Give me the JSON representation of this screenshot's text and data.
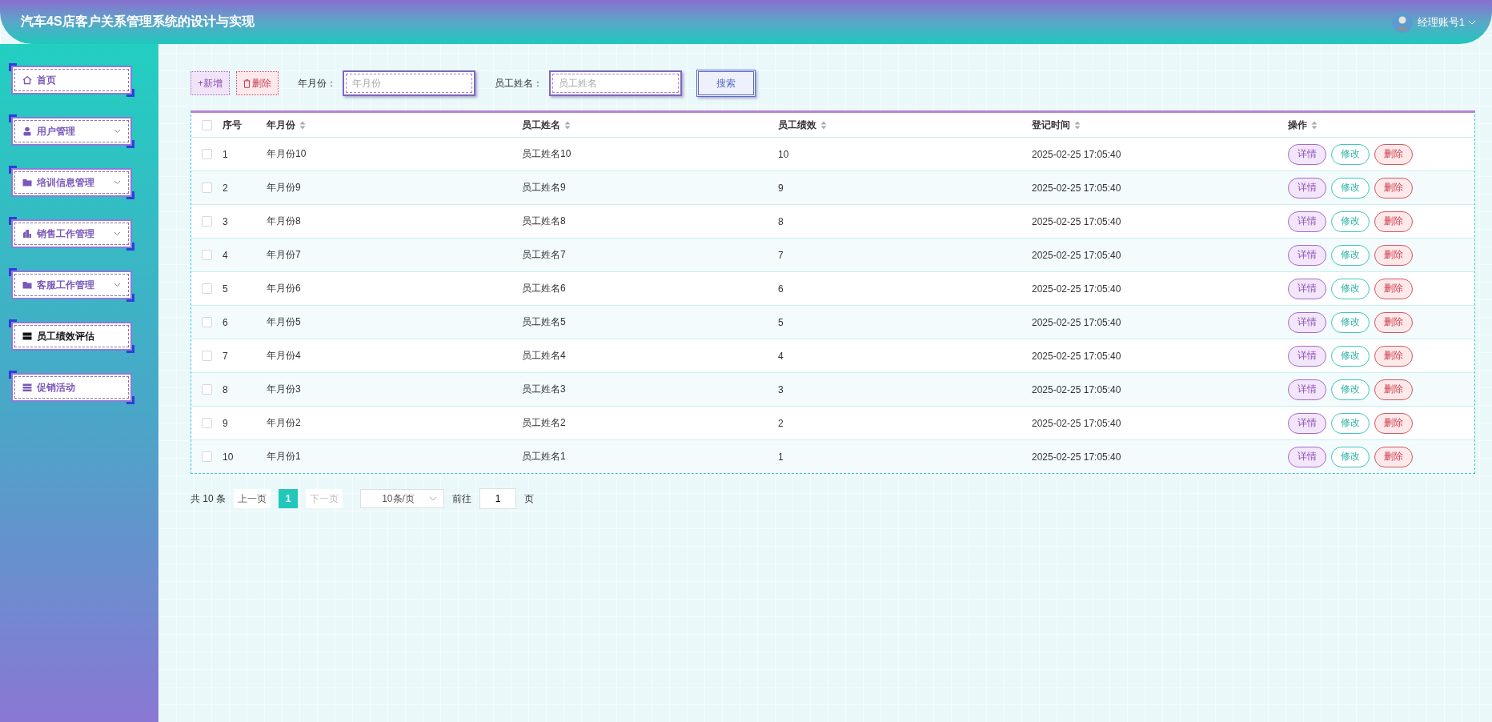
{
  "header": {
    "title": "汽车4S店客户关系管理系统的设计与实现",
    "user": "经理账号1"
  },
  "sidebar": {
    "items": [
      {
        "label": "首页",
        "kind": "link",
        "selected": false
      },
      {
        "label": "用户管理",
        "kind": "menu",
        "selected": false
      },
      {
        "label": "培训信息管理",
        "kind": "menu",
        "selected": false
      },
      {
        "label": "销售工作管理",
        "kind": "menu",
        "selected": false
      },
      {
        "label": "客服工作管理",
        "kind": "menu",
        "selected": false
      },
      {
        "label": "员工绩效评估",
        "kind": "link",
        "selected": true
      },
      {
        "label": "促销活动",
        "kind": "link",
        "selected": false
      }
    ]
  },
  "toolbar": {
    "add": "+新增",
    "delete": "删除",
    "filters": [
      {
        "label": "年月份：",
        "placeholder": "年月份"
      },
      {
        "label": "员工姓名：",
        "placeholder": "员工姓名"
      }
    ],
    "search": "搜索"
  },
  "table": {
    "all_checked": false,
    "columns": [
      {
        "label": "序号",
        "sortable": false
      },
      {
        "label": "年月份",
        "sortable": true
      },
      {
        "label": "员工姓名",
        "sortable": true
      },
      {
        "label": "员工绩效",
        "sortable": true
      },
      {
        "label": "登记时间",
        "sortable": true
      },
      {
        "label": "操作",
        "sortable": true
      }
    ],
    "rows": [
      {
        "checked": false,
        "cells": [
          "1",
          "年月份10",
          "员工姓名10",
          "10",
          "2025-02-25 17:05:40"
        ],
        "actions": [
          "详情",
          "修改",
          "删除"
        ]
      },
      {
        "checked": false,
        "cells": [
          "2",
          "年月份9",
          "员工姓名9",
          "9",
          "2025-02-25 17:05:40"
        ],
        "actions": [
          "详情",
          "修改",
          "删除"
        ]
      },
      {
        "checked": false,
        "cells": [
          "3",
          "年月份8",
          "员工姓名8",
          "8",
          "2025-02-25 17:05:40"
        ],
        "actions": [
          "详情",
          "修改",
          "删除"
        ]
      },
      {
        "checked": false,
        "cells": [
          "4",
          "年月份7",
          "员工姓名7",
          "7",
          "2025-02-25 17:05:40"
        ],
        "actions": [
          "详情",
          "修改",
          "删除"
        ]
      },
      {
        "checked": false,
        "cells": [
          "5",
          "年月份6",
          "员工姓名6",
          "6",
          "2025-02-25 17:05:40"
        ],
        "actions": [
          "详情",
          "修改",
          "删除"
        ]
      },
      {
        "checked": false,
        "cells": [
          "6",
          "年月份5",
          "员工姓名5",
          "5",
          "2025-02-25 17:05:40"
        ],
        "actions": [
          "详情",
          "修改",
          "删除"
        ]
      },
      {
        "checked": false,
        "cells": [
          "7",
          "年月份4",
          "员工姓名4",
          "4",
          "2025-02-25 17:05:40"
        ],
        "actions": [
          "详情",
          "修改",
          "删除"
        ]
      },
      {
        "checked": false,
        "cells": [
          "8",
          "年月份3",
          "员工姓名3",
          "3",
          "2025-02-25 17:05:40"
        ],
        "actions": [
          "详情",
          "修改",
          "删除"
        ]
      },
      {
        "checked": false,
        "cells": [
          "9",
          "年月份2",
          "员工姓名2",
          "2",
          "2025-02-25 17:05:40"
        ],
        "actions": [
          "详情",
          "修改",
          "删除"
        ]
      },
      {
        "checked": false,
        "cells": [
          "10",
          "年月份1",
          "员工姓名1",
          "1",
          "2025-02-25 17:05:40"
        ],
        "actions": [
          "详情",
          "修改",
          "删除"
        ]
      }
    ]
  },
  "pagination": {
    "total": "共 10 条",
    "prev": "上一页",
    "pages": [
      {
        "label": "1",
        "selected": true
      }
    ],
    "next": "下一页",
    "next_disabled": true,
    "page_size": "10条/页",
    "goto_label": "前往",
    "goto_value": "1",
    "goto_suffix": "页"
  }
}
